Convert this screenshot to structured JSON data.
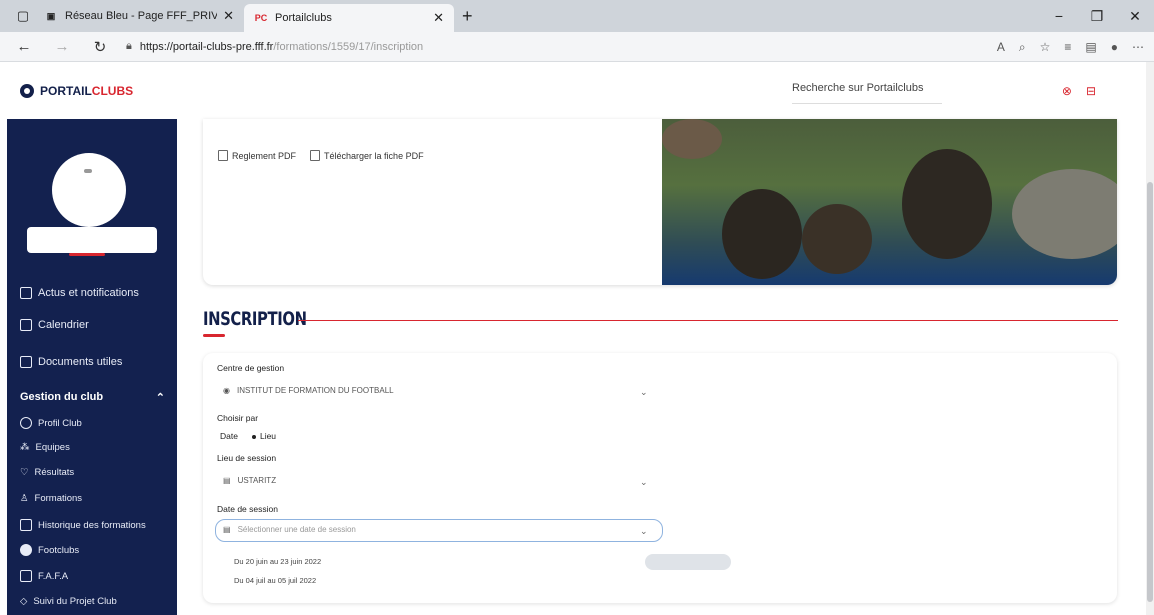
{
  "browser": {
    "tabs": [
      {
        "label": "Réseau Bleu - Page FFF_PRIVATE"
      },
      {
        "label": "Portailclubs",
        "favicon": "PC"
      }
    ],
    "url_host": "https://portail-clubs-pre.fff.fr",
    "url_path": "/formations/1559/17/inscription"
  },
  "header": {
    "logo_text": "PORTAIL",
    "logo_accent": "CLUBS",
    "search_placeholder": "Recherche sur Portailclubs"
  },
  "sidebar": {
    "items": [
      {
        "label": "Actus et notifications",
        "icon": "bell-icon"
      },
      {
        "label": "Calendrier",
        "icon": "calendar-icon"
      },
      {
        "label": "Documents utiles",
        "icon": "document-icon"
      }
    ],
    "section_title": "Gestion du club",
    "sub_items": [
      {
        "label": "Profil Club",
        "icon": "club-icon"
      },
      {
        "label": "Equipes",
        "icon": "team-icon"
      },
      {
        "label": "Résultats",
        "icon": "trophy-icon"
      },
      {
        "label": "Formations",
        "icon": "graduation-icon"
      },
      {
        "label": "Historique des formations",
        "icon": "history-icon"
      },
      {
        "label": "Footclubs",
        "icon": "ball-icon"
      },
      {
        "label": "F.A.F.A",
        "icon": "grid-icon"
      },
      {
        "label": "Suivi du Projet Club",
        "icon": "target-icon"
      }
    ]
  },
  "main": {
    "links": [
      {
        "label": "Reglement PDF"
      },
      {
        "label": "Télécharger la fiche PDF"
      }
    ],
    "section_title": "INSCRIPTION",
    "form": {
      "centre_label": "Centre de gestion",
      "centre_value": "INSTITUT DE FORMATION DU FOOTBALL",
      "choisir_label": "Choisir par",
      "radio_date": "Date",
      "radio_lieu": "Lieu",
      "lieu_label": "Lieu de session",
      "lieu_value": "USTARITZ",
      "date_label": "Date de session",
      "date_placeholder": "Sélectionner une date de session",
      "options": [
        "Du 20 juin au 23 juin 2022",
        "Du 04 juil au 05 juil 2022"
      ]
    }
  },
  "colors": {
    "brand_navy": "#13214f",
    "brand_red": "#d8262f"
  }
}
